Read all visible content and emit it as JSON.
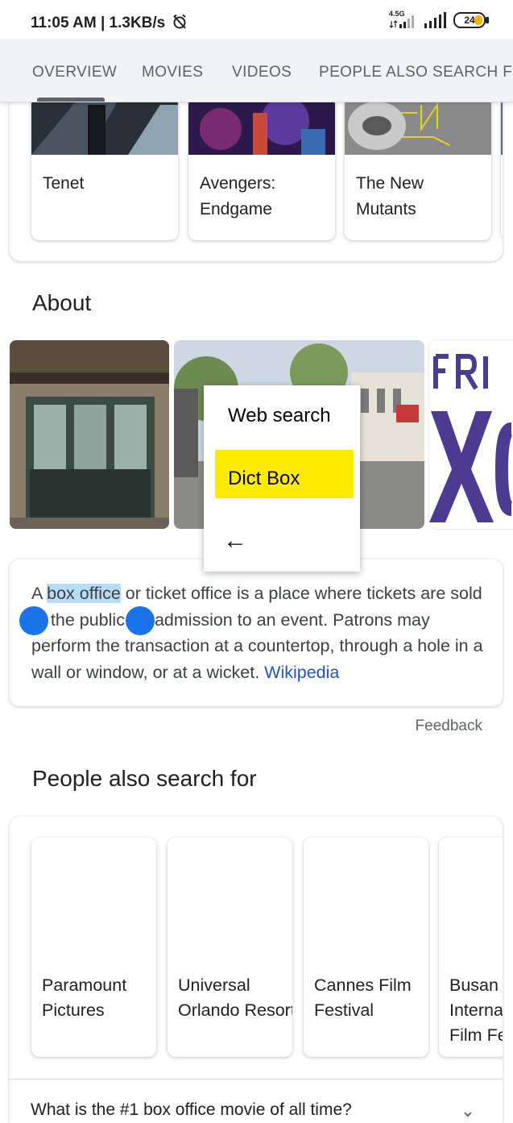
{
  "status_bar": {
    "time_speed": "11:05 AM | 1.3KB/s",
    "network_label": "4.5G",
    "battery": "24"
  },
  "tabs": [
    {
      "label": "OVERVIEW"
    },
    {
      "label": "MOVIES"
    },
    {
      "label": "VIDEOS"
    },
    {
      "label": "PEOPLE ALSO SEARCH FOR"
    }
  ],
  "movies": [
    {
      "title": "Tenet"
    },
    {
      "title": "Avengers: Endgame"
    },
    {
      "title": "The New Mutants"
    }
  ],
  "about": {
    "title": "About",
    "description_before": "A ",
    "selected_text": "box office",
    "description_after": " or ticket office is a place where tickets are sold to the public for admission to an event. Patrons may perform the transaction at a countertop, through a hole in a wall or window, or at a wicket. ",
    "source_link": "Wikipedia",
    "feedback": "Feedback"
  },
  "context_menu": {
    "web_search": "Web search",
    "dict_box": "Dict Box",
    "back_glyph": "←"
  },
  "people_also_search": {
    "title": "People also search for",
    "items": [
      {
        "name": "Paramount Pictures"
      },
      {
        "name": "Universal Orlando Resort"
      },
      {
        "name": "Cannes Film Festival"
      },
      {
        "name": "Busan International Film Festival"
      }
    ],
    "question": "What is the #1 box office movie of all time?",
    "chevron_glyph": "⌄"
  },
  "colors": {
    "selection": "#b9dcf5",
    "selection_handle": "#1a73e8",
    "highlight": "#ffeb00",
    "link": "#1a56c4",
    "battery_fill": "#f4b400"
  }
}
